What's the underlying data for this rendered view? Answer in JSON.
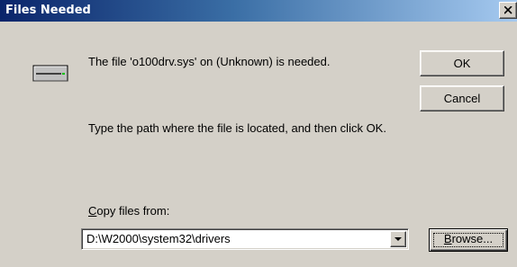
{
  "window": {
    "title": "Files Needed",
    "close_icon": "close-icon"
  },
  "icon": {
    "name": "disk-drive-icon"
  },
  "message": {
    "file_needed": "The file 'o100drv.sys' on (Unknown) is needed.",
    "instructions": "Type the path where the file is located, and then click OK.",
    "copy_label_mnemonic": "C",
    "copy_label_rest": "opy files from:"
  },
  "buttons": {
    "ok": "OK",
    "cancel": "Cancel",
    "browse_mnemonic": "B",
    "browse_rest": "rowse..."
  },
  "copy_from": {
    "value": "D:\\W2000\\system32\\drivers",
    "dropdown_icon": "chevron-down-icon"
  },
  "colors": {
    "title_gradient_start": "#0a246a",
    "title_gradient_end": "#a6caf0",
    "dialog_face": "#d4d0c8"
  }
}
